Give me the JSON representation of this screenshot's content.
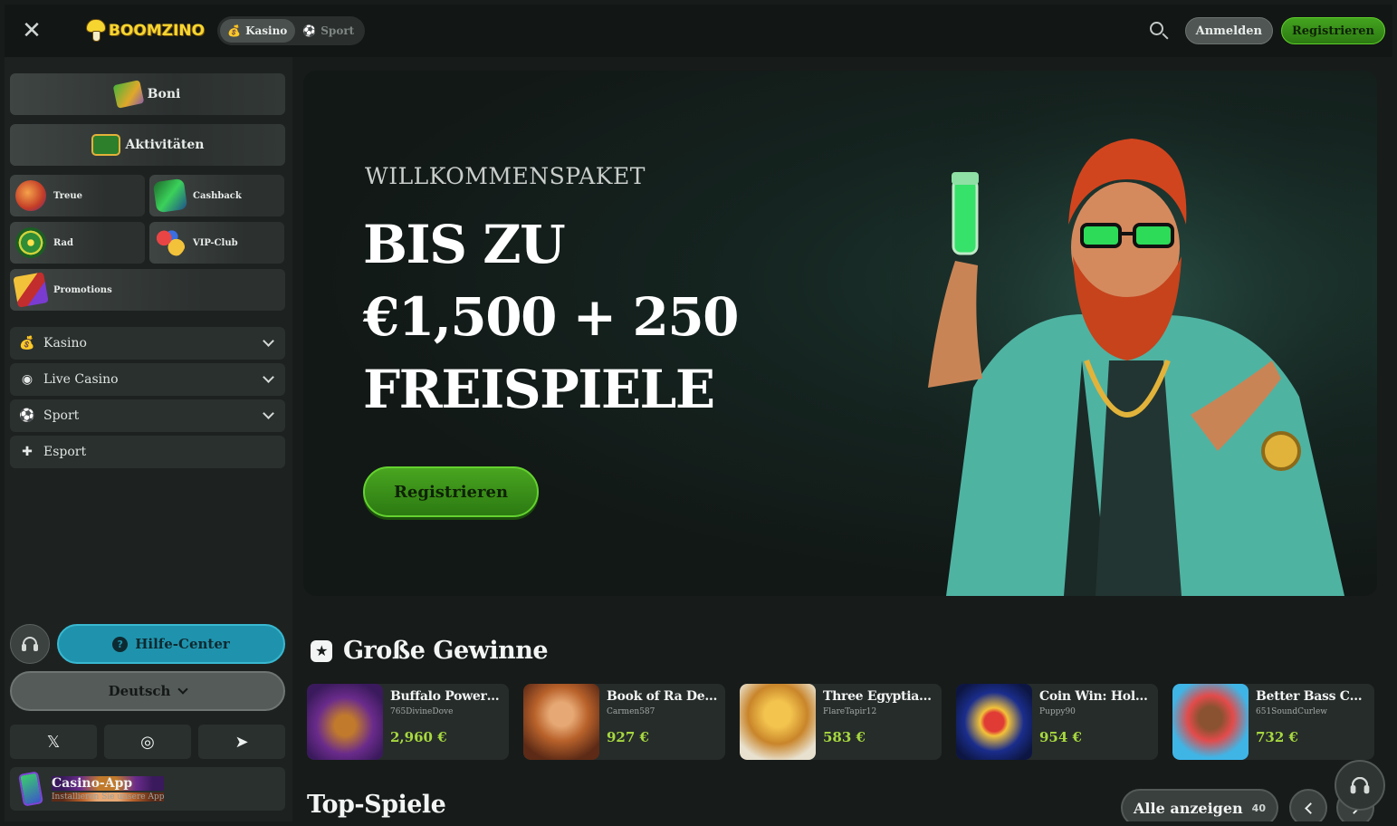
{
  "topbar": {
    "logo_text": "BOOMZINO",
    "modes": [
      {
        "label": "Kasino",
        "icon": "money-bag-icon",
        "active": true
      },
      {
        "label": "Sport",
        "icon": "soccer-ball-icon",
        "active": false
      }
    ],
    "login_label": "Anmelden",
    "register_label": "Registrieren"
  },
  "sidebar": {
    "boni": "Boni",
    "aktivitaeten": "Aktivitäten",
    "tiles": [
      {
        "label": "Treue",
        "icon": "loyalty-icon"
      },
      {
        "label": "Cashback",
        "icon": "cashback-icon"
      },
      {
        "label": "Rad",
        "icon": "wheel-icon"
      },
      {
        "label": "VIP-Club",
        "icon": "vip-chips-icon"
      },
      {
        "label": "Promotions",
        "icon": "promotions-icon"
      }
    ],
    "nav": [
      {
        "label": "Kasino",
        "icon": "money-bag-icon",
        "expandable": true
      },
      {
        "label": "Live Casino",
        "icon": "live-broadcast-icon",
        "expandable": true
      },
      {
        "label": "Sport",
        "icon": "soccer-ball-icon",
        "expandable": true
      },
      {
        "label": "Esport",
        "icon": "gamepad-icon",
        "expandable": false
      }
    ],
    "help_label": "Hilfe-Center",
    "language": "Deutsch",
    "socials": [
      "x-icon",
      "instagram-icon",
      "telegram-icon"
    ],
    "app": {
      "title": "Casino-App",
      "subtitle": "Installieren Sie unsere App"
    }
  },
  "hero": {
    "kicker": "WILLKOMMENSPAKET",
    "line1": "BIS ZU",
    "line2": "€1,500 + 250",
    "line3": "FREISPIELE",
    "cta_label": "Registrieren"
  },
  "big_wins": {
    "title": "Große Gewinne",
    "items": [
      {
        "game": "Buffalo Power H...",
        "user": "765DivineDove",
        "amount": "2,960 €"
      },
      {
        "game": "Book of Ra Deluxe",
        "user": "Carmen587",
        "amount": "927 €"
      },
      {
        "game": "Three Egyptian T...",
        "user": "FlareTapir12",
        "amount": "583 €"
      },
      {
        "game": "Coin Win: Hold T...",
        "user": "Puppy90",
        "amount": "954 €"
      },
      {
        "game": "Better Bass Cash",
        "user": "651SoundCurlew",
        "amount": "732 €"
      }
    ]
  },
  "top_games": {
    "title": "Top-Spiele",
    "view_all_label": "Alle anzeigen",
    "count": "40"
  },
  "colors": {
    "accent_green": "#43a31f",
    "help_blue": "#1f93ad",
    "win_amount": "#a7d83f",
    "background": "#171b1a"
  }
}
